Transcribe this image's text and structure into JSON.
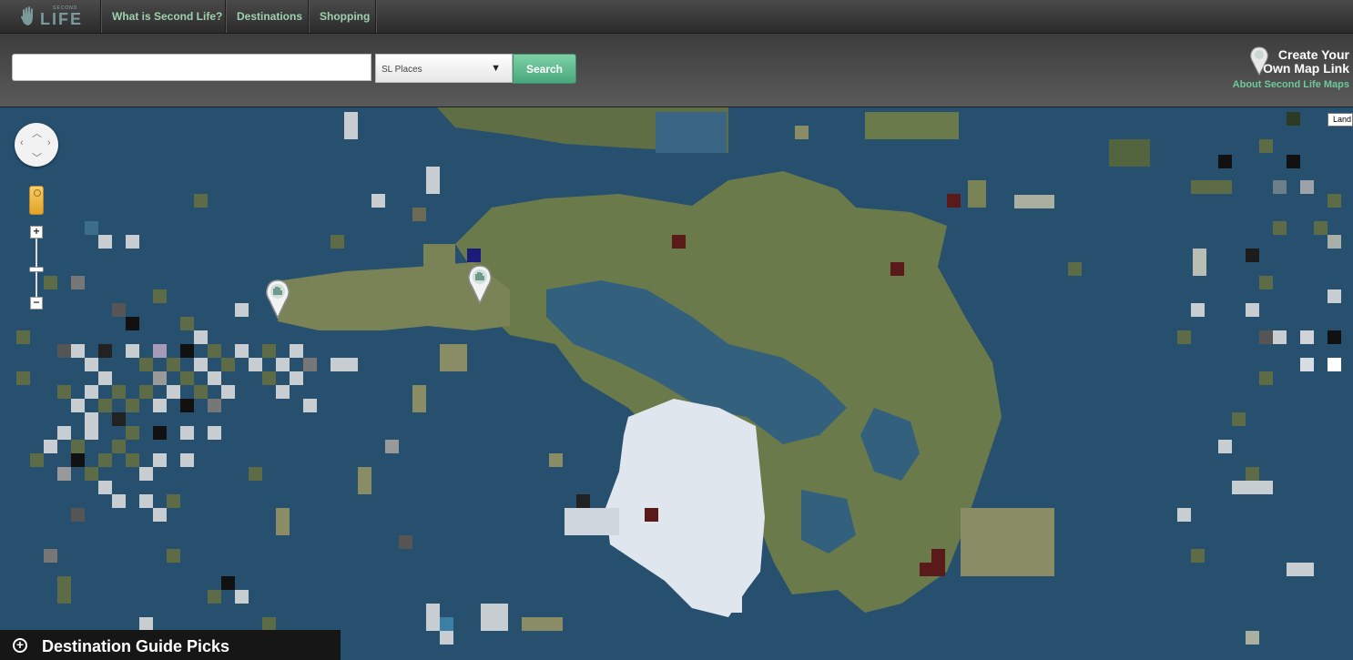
{
  "nav": {
    "logo_small": "SECOND",
    "logo_big": "LIFE",
    "links": [
      "What is Second Life?",
      "Destinations",
      "Shopping"
    ]
  },
  "search": {
    "value": "",
    "placeholder": "",
    "select_value": "SL Places",
    "button_label": "Search"
  },
  "header_right": {
    "create_line1": "Create Your",
    "create_line2": "Own Map Link",
    "about": "About Second Life Maps"
  },
  "map": {
    "land_button": "Land",
    "water_color": "#27506f",
    "land_colors": [
      "#6b7a4a",
      "#5f6e45",
      "#7a8356",
      "#52653f",
      "#8a8c66"
    ],
    "snow_color": "#dfe6ee",
    "markers": 2
  },
  "destination_panel": {
    "title": "Destination Guide Picks"
  },
  "colors": {
    "accent": "#4aa77d",
    "nav_link": "#9fd0b0",
    "about_link": "#6fc99b"
  }
}
